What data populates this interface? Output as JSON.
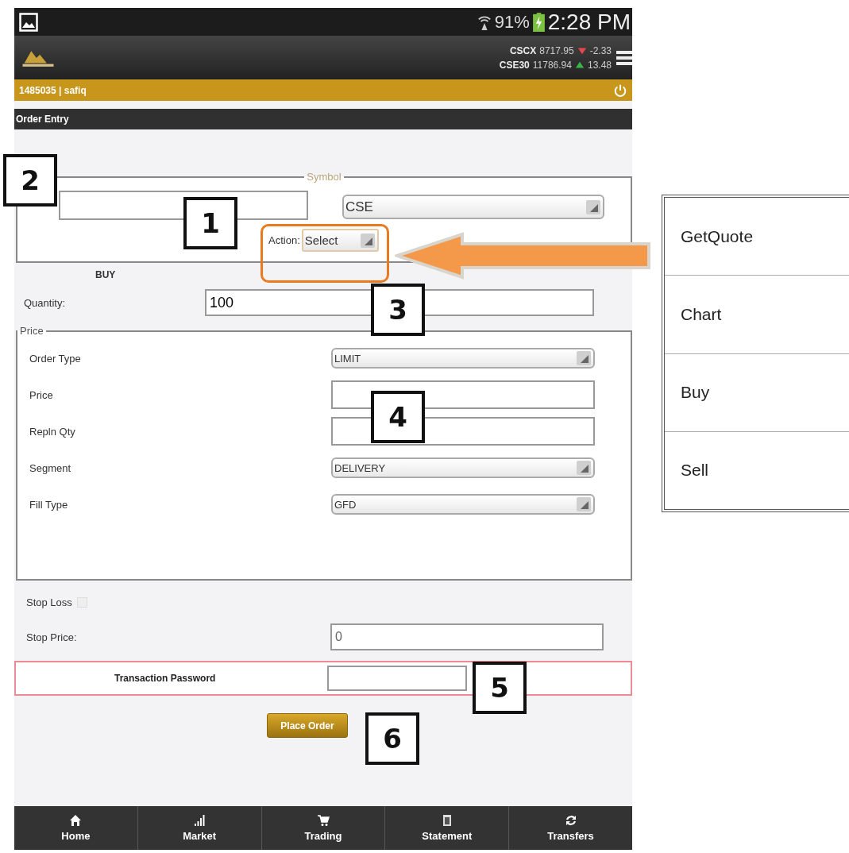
{
  "status_bar": {
    "battery": "91%",
    "time": "2:28 PM"
  },
  "indices": [
    {
      "name": "CSCX",
      "value": "8717.95",
      "change": "-2.33",
      "rising": false
    },
    {
      "name": "CSE30",
      "value": "11786.94",
      "change": "13.48",
      "rising": true
    }
  ],
  "user_bar": {
    "account": "1485035 | safiq"
  },
  "page_title": "Order Entry",
  "form": {
    "symbol_legend": "Symbol",
    "exchange": "CSE",
    "action_label": "Action:",
    "action": "Select",
    "side": "BUY",
    "quantity_label": "Quantity:",
    "quantity": "100",
    "price_legend": "Price",
    "price_rows": [
      {
        "label": "Order Type",
        "kind": "select",
        "value": "LIMIT"
      },
      {
        "label": "Price",
        "kind": "input"
      },
      {
        "label": "Repln Qty",
        "kind": "input"
      },
      {
        "label": "Segment",
        "kind": "select",
        "value": "DELIVERY"
      },
      {
        "label": "Fill Type",
        "kind": "select",
        "value": "GFD"
      }
    ],
    "stop_loss_label": "Stop Loss",
    "stop_loss_checked": false,
    "stop_price_label": "Stop Price:",
    "stop_price": "0",
    "password_label": "Transaction Password",
    "place_order": "Place Order"
  },
  "nav": [
    {
      "label": "Home"
    },
    {
      "label": "Market"
    },
    {
      "label": "Trading"
    },
    {
      "label": "Statement"
    },
    {
      "label": "Transfers"
    }
  ],
  "action_menu": {
    "items": [
      "GetQuote",
      "Chart",
      "Buy",
      "Sell"
    ]
  },
  "annotations": {
    "markers": [
      "1",
      "2",
      "3",
      "4",
      "5",
      "6"
    ]
  }
}
